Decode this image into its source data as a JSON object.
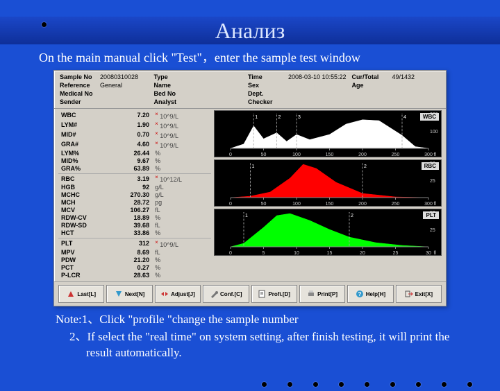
{
  "slide": {
    "title": "Анализ",
    "intro": "On the main manual click \"Test\"，enter the sample test window",
    "note1": "Note:1、Click \"profile \"change the sample number",
    "note2": "2、If select the \"real time\" on system setting, after finish testing, it will print the result automatically."
  },
  "info": {
    "sample_no_lbl": "Sample No",
    "sample_no": "20080310028",
    "type_lbl": "Type",
    "type": "",
    "time_lbl": "Time",
    "time": "2008-03-10 10:55:22",
    "curtotal_lbl": "Cur/Total",
    "curtotal": "49/1432",
    "reference_lbl": "Reference",
    "reference": "General",
    "name_lbl": "Name",
    "name": "",
    "sex_lbl": "Sex",
    "sex": "",
    "age_lbl": "Age",
    "age": "",
    "medical_no_lbl": "Medical No",
    "medical_no": "",
    "bed_no_lbl": "Bed No",
    "bed_no": "",
    "dept_lbl": "Dept.",
    "dept": "",
    "sender_lbl": "Sender",
    "sender": "",
    "analyst_lbl": "Analyst",
    "analyst": "",
    "checker_lbl": "Checker",
    "checker": ""
  },
  "params": [
    {
      "k": "WBC",
      "v": "7.20",
      "u": "10^9/L",
      "f": "×"
    },
    {
      "k": "LYM#",
      "v": "1.90",
      "u": "10^9/L",
      "f": "×"
    },
    {
      "k": "MID#",
      "v": "0.70",
      "u": "10^9/L",
      "f": "×"
    },
    {
      "k": "GRA#",
      "v": "4.60",
      "u": "10^9/L",
      "f": "×"
    },
    {
      "k": "LYM%",
      "v": "26.44",
      "u": "%"
    },
    {
      "k": "MID%",
      "v": "9.67",
      "u": "%"
    },
    {
      "k": "GRA%",
      "v": "63.89",
      "u": "%"
    }
  ],
  "params2": [
    {
      "k": "RBC",
      "v": "3.19",
      "u": "10^12/L",
      "f": "×"
    },
    {
      "k": "HGB",
      "v": "92",
      "u": "g/L"
    },
    {
      "k": "MCHC",
      "v": "270.30",
      "u": "g/L"
    },
    {
      "k": "MCH",
      "v": "28.72",
      "u": "pg"
    },
    {
      "k": "MCV",
      "v": "106.27",
      "u": "fL"
    },
    {
      "k": "RDW-CV",
      "v": "18.89",
      "u": "%"
    },
    {
      "k": "RDW-SD",
      "v": "39.68",
      "u": "fL"
    },
    {
      "k": "HCT",
      "v": "33.86",
      "u": "%"
    }
  ],
  "params3": [
    {
      "k": "PLT",
      "v": "312",
      "u": "10^9/L",
      "f": "×"
    },
    {
      "k": "MPV",
      "v": "8.69",
      "u": "fL"
    },
    {
      "k": "PDW",
      "v": "21.20",
      "u": "%"
    },
    {
      "k": "PCT",
      "v": "0.27",
      "u": "%"
    },
    {
      "k": "P-LCR",
      "v": "28.63",
      "u": "%"
    }
  ],
  "charts": {
    "wbc": {
      "label": "WBC",
      "xmax": 300,
      "xticks": [
        0,
        50,
        100,
        150,
        200,
        250,
        300
      ],
      "xlabel": "fl",
      "markers": [
        {
          "x": 35,
          "n": "1"
        },
        {
          "x": 70,
          "n": "2"
        },
        {
          "x": 100,
          "n": "3"
        },
        {
          "x": 260,
          "n": "4"
        }
      ],
      "ylabels": [
        "100",
        "200"
      ]
    },
    "rbc": {
      "label": "RBC",
      "xmax": 300,
      "xticks": [
        0,
        50,
        100,
        150,
        200,
        250,
        300
      ],
      "xlabel": "fl",
      "markers": [
        {
          "x": 30,
          "n": "1"
        },
        {
          "x": 200,
          "n": "2"
        }
      ],
      "ylabels": [
        "25",
        "50"
      ]
    },
    "plt": {
      "label": "PLT",
      "xmax": 30,
      "xticks": [
        0,
        5,
        10,
        15,
        20,
        25,
        30
      ],
      "xlabel": "fl",
      "markers": [
        {
          "x": 2,
          "n": "1"
        },
        {
          "x": 18,
          "n": "2"
        }
      ],
      "ylabels": [
        "25",
        "50"
      ]
    }
  },
  "chart_data": [
    {
      "type": "area",
      "title": "WBC",
      "xlabel": "fl",
      "ylabel": "",
      "xlim": [
        0,
        300
      ],
      "ylim": [
        0,
        200
      ],
      "x": [
        0,
        20,
        35,
        50,
        70,
        85,
        100,
        120,
        150,
        175,
        200,
        225,
        260,
        280,
        300
      ],
      "values": [
        0,
        25,
        130,
        55,
        90,
        40,
        80,
        50,
        80,
        140,
        165,
        160,
        75,
        10,
        0
      ],
      "color": "#ffffff",
      "markers": [
        35,
        70,
        100,
        260
      ]
    },
    {
      "type": "area",
      "title": "RBC",
      "xlabel": "fl",
      "ylabel": "",
      "xlim": [
        0,
        300
      ],
      "ylim": [
        0,
        50
      ],
      "x": [
        0,
        30,
        60,
        90,
        110,
        130,
        160,
        200,
        250,
        300
      ],
      "values": [
        0,
        2,
        8,
        28,
        48,
        42,
        22,
        6,
        1,
        0
      ],
      "color": "#ff0000",
      "markers": [
        30,
        200
      ]
    },
    {
      "type": "area",
      "title": "PLT",
      "xlabel": "fl",
      "ylabel": "",
      "xlim": [
        0,
        30
      ],
      "ylim": [
        0,
        50
      ],
      "x": [
        0,
        2,
        5,
        7,
        9,
        12,
        15,
        18,
        22,
        26,
        30
      ],
      "values": [
        0,
        5,
        28,
        45,
        48,
        38,
        25,
        14,
        6,
        2,
        0
      ],
      "color": "#00ff00",
      "markers": [
        2,
        18
      ]
    }
  ],
  "toolbar": {
    "last": "Last[L]",
    "next": "Next[N]",
    "adjust": "Adjust[J]",
    "conf": "Conf.[C]",
    "profi": "Profi.[D]",
    "print": "Print[P]",
    "help": "Help[H]",
    "exit": "Exit[X]"
  }
}
